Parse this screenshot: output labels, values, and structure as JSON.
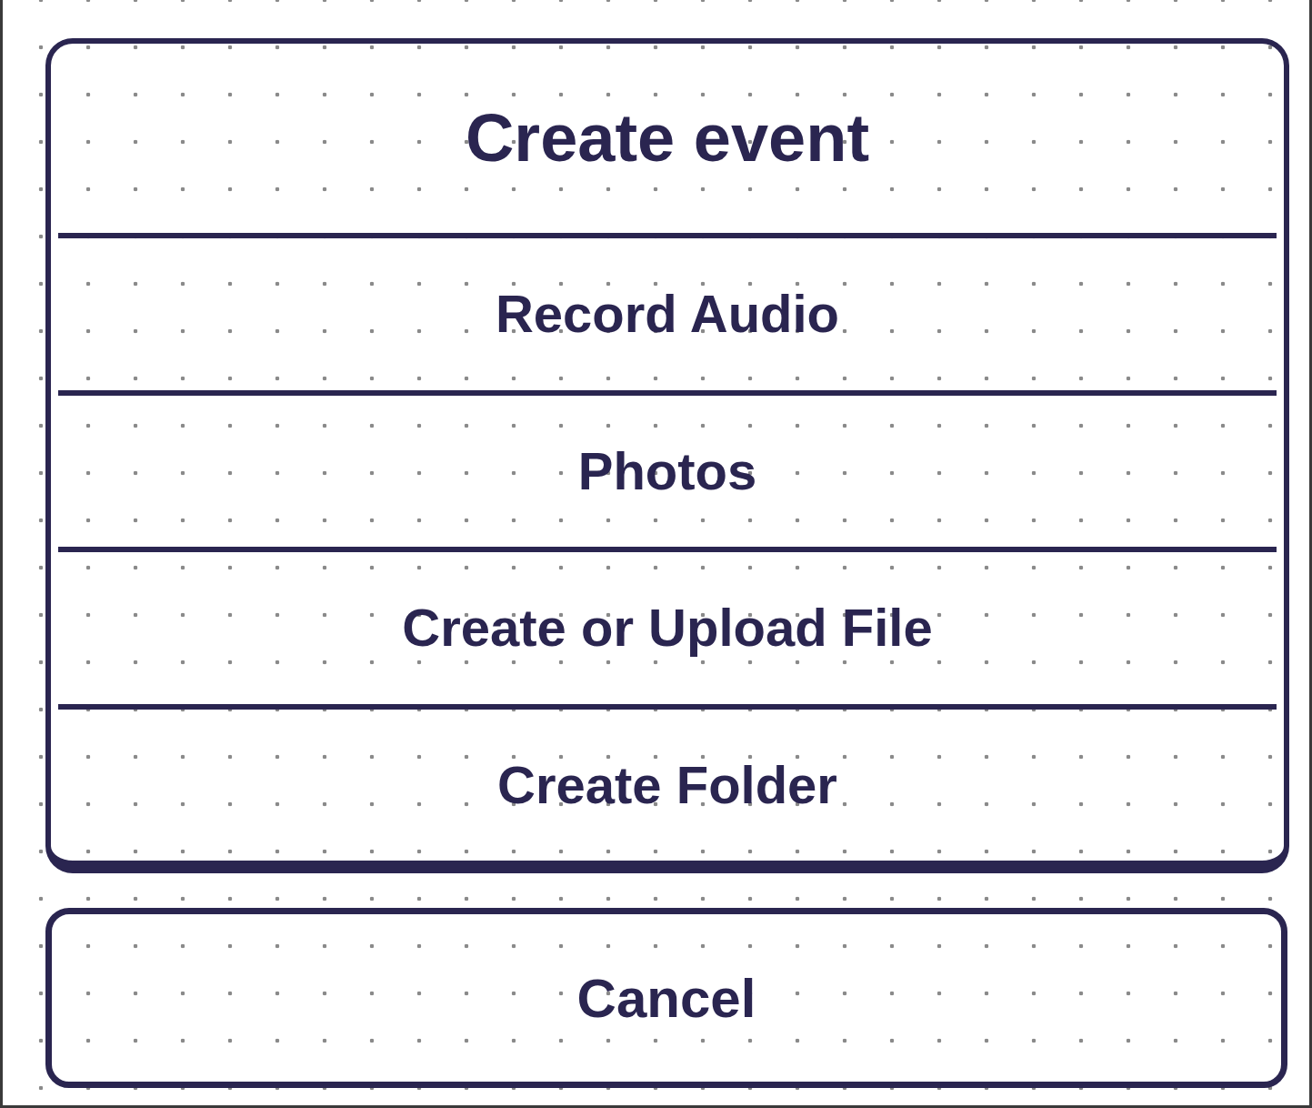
{
  "sheet": {
    "title": "Create event",
    "actions": [
      {
        "label": "Record Audio"
      },
      {
        "label": "Photos"
      },
      {
        "label": "Create or Upload File"
      },
      {
        "label": "Create Folder"
      }
    ]
  },
  "cancel": {
    "label": "Cancel"
  }
}
